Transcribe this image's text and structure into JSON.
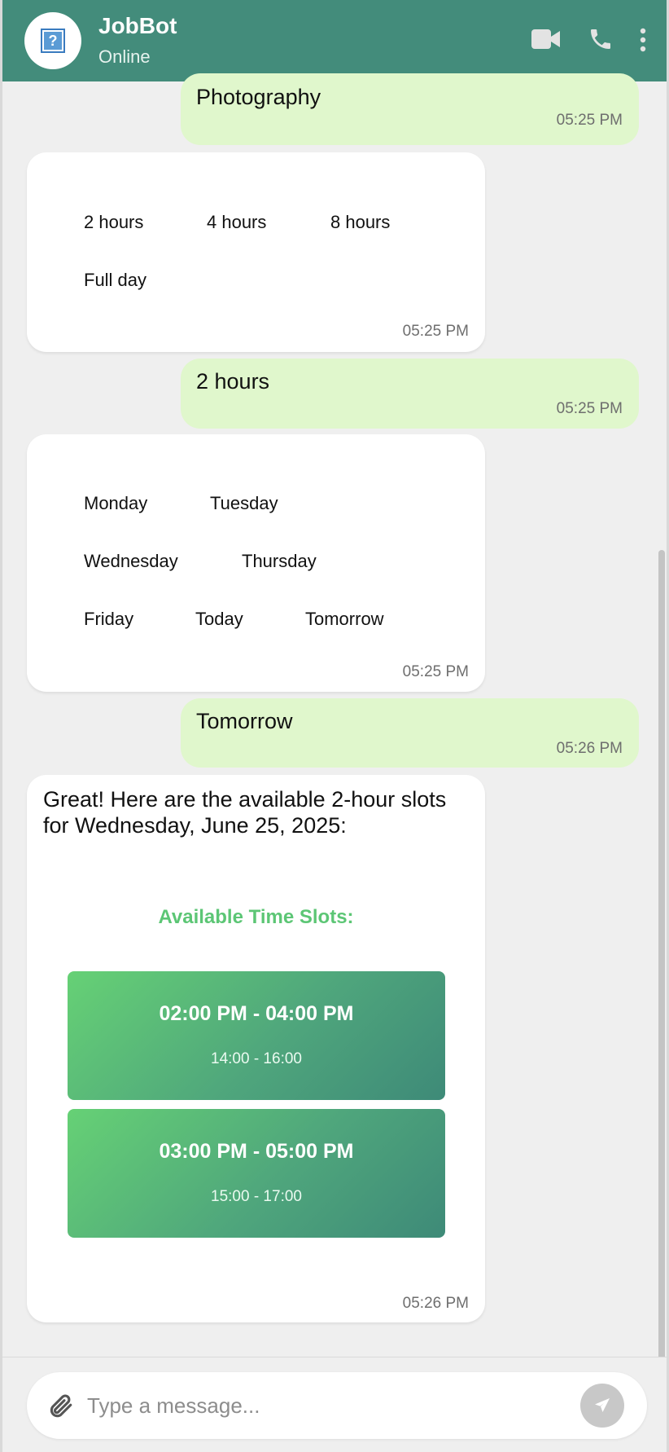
{
  "header": {
    "title": "JobBot",
    "status": "Online",
    "avatar_icon": "help-question-icon",
    "icons": [
      "video-call-icon",
      "phone-icon",
      "more-vertical-icon"
    ],
    "color": "#438c7b"
  },
  "messages": [
    {
      "side": "out",
      "text": "Photography",
      "time": "05:25 PM"
    },
    {
      "side": "in",
      "options": [
        "2 hours",
        "4 hours",
        "8 hours",
        "Full day"
      ],
      "time": "05:25 PM"
    },
    {
      "side": "out",
      "text": "2 hours",
      "time": "05:25 PM"
    },
    {
      "side": "in",
      "options": [
        "Monday",
        "Tuesday",
        "Wednesday",
        "Thursday",
        "Friday",
        "Today",
        "Tomorrow"
      ],
      "time": "05:25 PM"
    },
    {
      "side": "out",
      "text": "Tomorrow",
      "time": "05:26 PM"
    },
    {
      "side": "in",
      "text": "Great! Here are the available 2-hour slots for Wednesday, June 25, 2025:",
      "heading": "Available Time Slots:",
      "slots": [
        {
          "label": "02:00 PM - 04:00 PM",
          "sub": "14:00 - 16:00"
        },
        {
          "label": "03:00 PM - 05:00 PM",
          "sub": "15:00 - 17:00"
        }
      ],
      "time": "05:26 PM"
    }
  ],
  "composer": {
    "placeholder": "Type a message...",
    "attach_icon": "paperclip-icon",
    "send_icon": "send-icon"
  },
  "colors": {
    "outgoing_bubble": "#e0f7cc",
    "incoming_bubble": "#ffffff",
    "accent_green": "#5cc675",
    "chat_bg": "#efefef"
  }
}
